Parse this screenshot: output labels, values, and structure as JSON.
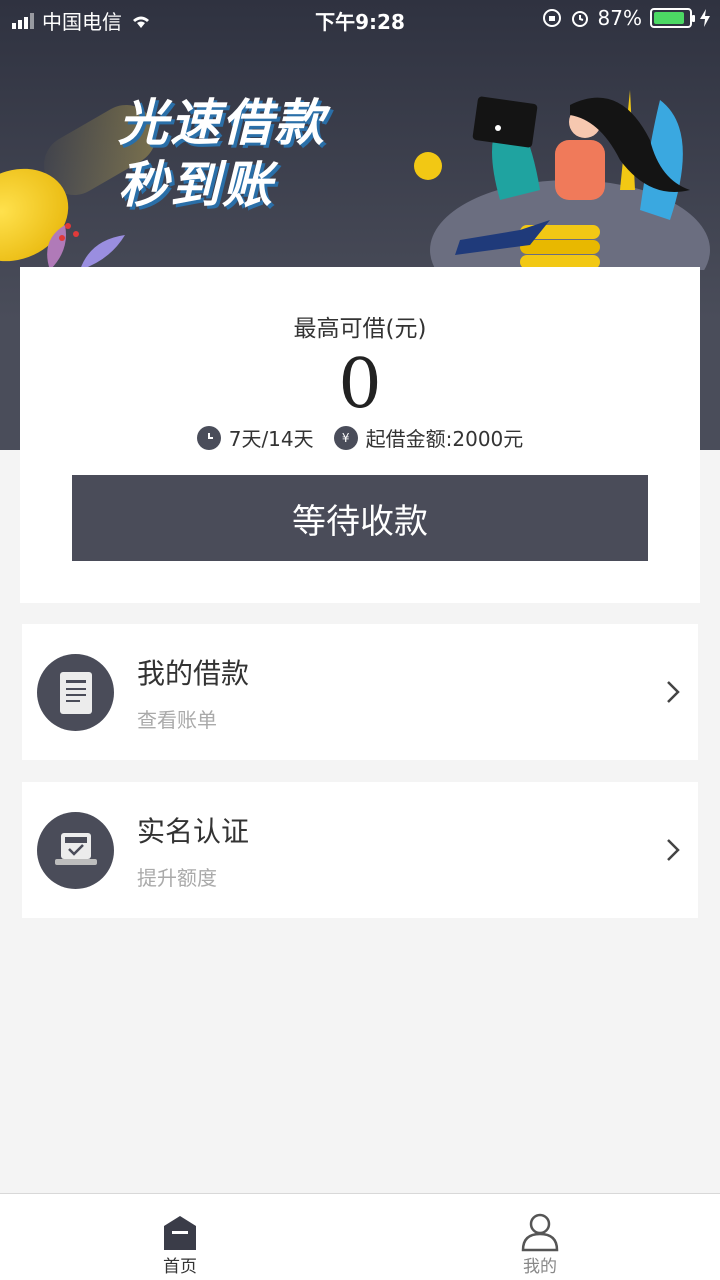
{
  "status_bar": {
    "carrier": "中国电信",
    "time": "下午9:28",
    "battery": "87%",
    "battery_level": 0.87
  },
  "hero": {
    "title_line1": "光速借款",
    "title_line2": "秒到账"
  },
  "loan_card": {
    "label": "最高可借(元)",
    "amount": "0",
    "term": "7天/14天",
    "min_amount": "起借金额:2000元",
    "term_icon": "clock-icon",
    "amount_icon": "yen-icon",
    "yen_glyph": "¥",
    "button_label": "等待收款"
  },
  "menu": [
    {
      "title": "我的借款",
      "subtitle": "查看账单",
      "icon": "bill-icon"
    },
    {
      "title": "实名认证",
      "subtitle": "提升额度",
      "icon": "id-verify-icon"
    }
  ],
  "tab_bar": {
    "tabs": [
      {
        "label": "首页",
        "icon": "home-icon",
        "active": true
      },
      {
        "label": "我的",
        "icon": "user-icon",
        "active": false
      }
    ]
  },
  "colors": {
    "primary": "#4a4c59",
    "background": "#f4f4f4",
    "accent_coin": "#f2c814"
  }
}
